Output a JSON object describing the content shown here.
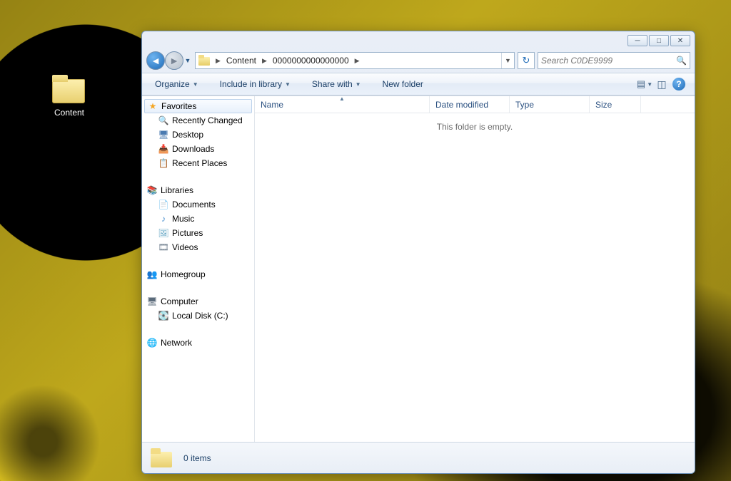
{
  "desktop": {
    "icon_label": "Content"
  },
  "titlebar": {
    "min": "—",
    "max": "❐",
    "close": "✕"
  },
  "nav": {
    "back": "←",
    "forward": "→"
  },
  "breadcrumb": {
    "seg1": "Content",
    "seg2": "0000000000000000"
  },
  "search": {
    "placeholder": "Search C0DE9999"
  },
  "toolbar": {
    "organize": "Organize",
    "include": "Include in library",
    "sharewith": "Share with",
    "newfolder": "New folder"
  },
  "sidebar": {
    "favorites": "Favorites",
    "fav_items": {
      "rc": "Recently Changed",
      "desktop": "Desktop",
      "downloads": "Downloads",
      "recent": "Recent Places"
    },
    "libraries": "Libraries",
    "lib_items": {
      "docs": "Documents",
      "music": "Music",
      "pics": "Pictures",
      "vids": "Videos"
    },
    "homegroup": "Homegroup",
    "computer": "Computer",
    "comp_items": {
      "c": "Local Disk (C:)"
    },
    "network": "Network"
  },
  "columns": {
    "name": "Name",
    "date": "Date modified",
    "type": "Type",
    "size": "Size"
  },
  "content": {
    "empty": "This folder is empty."
  },
  "status": {
    "text": "0 items"
  }
}
